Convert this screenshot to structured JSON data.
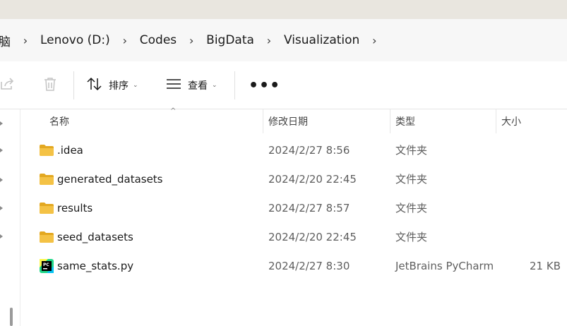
{
  "breadcrumb": {
    "items": [
      "脑",
      "Lenovo (D:)",
      "Codes",
      "BigData",
      "Visualization"
    ]
  },
  "toolbar": {
    "share_icon": "share-icon",
    "delete_icon": "trash-icon",
    "sort_label": "排序",
    "view_label": "查看",
    "more_label": "•••"
  },
  "columns": {
    "name": "名称",
    "date": "修改日期",
    "type": "类型",
    "size": "大小"
  },
  "files": [
    {
      "name": ".idea",
      "date": "2024/2/27 8:56",
      "type": "文件夹",
      "size": "",
      "icon": "folder-icon"
    },
    {
      "name": "generated_datasets",
      "date": "2024/2/20 22:45",
      "type": "文件夹",
      "size": "",
      "icon": "folder-icon"
    },
    {
      "name": "results",
      "date": "2024/2/27 8:57",
      "type": "文件夹",
      "size": "",
      "icon": "folder-icon"
    },
    {
      "name": "seed_datasets",
      "date": "2024/2/20 22:45",
      "type": "文件夹",
      "size": "",
      "icon": "folder-icon"
    },
    {
      "name": "same_stats.py",
      "date": "2024/2/27 8:30",
      "type": "JetBrains PyCharm",
      "size": "21 KB",
      "icon": "pycharm-file-icon"
    }
  ],
  "colors": {
    "folder": "#f4c245",
    "folder_dark": "#e3a821",
    "accent": "#1a1a1a"
  }
}
